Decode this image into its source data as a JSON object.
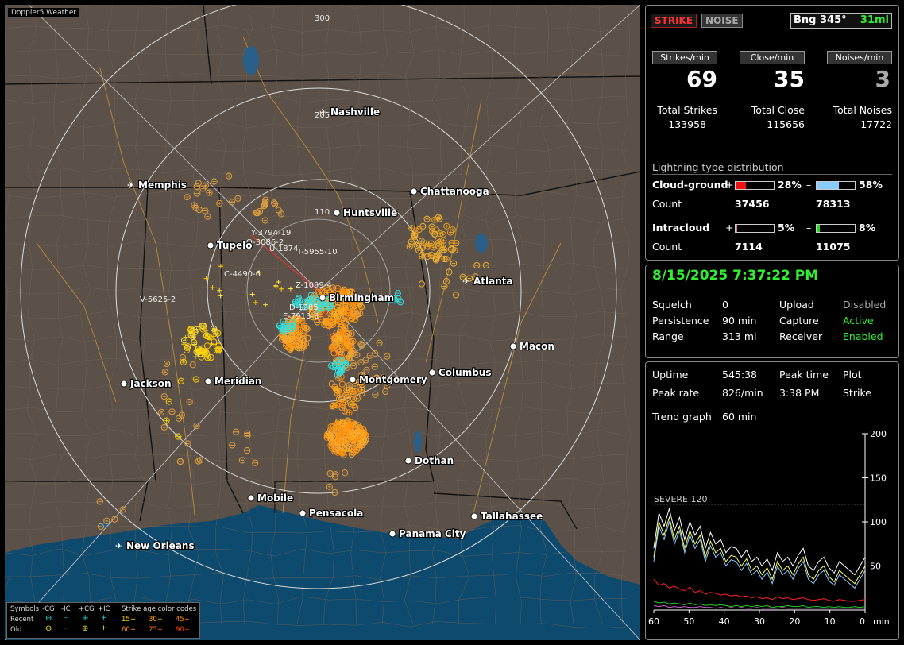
{
  "app": {
    "title": "Doppler5 Weather"
  },
  "map": {
    "range_labels": [
      "300",
      "205",
      "110"
    ],
    "cities": [
      {
        "name": "Nashville",
        "airport": true
      },
      {
        "name": "Memphis",
        "airport": true
      },
      {
        "name": "Chattanooga",
        "airport": false
      },
      {
        "name": "Huntsville",
        "airport": false
      },
      {
        "name": "Tupelo",
        "airport": false
      },
      {
        "name": "Atlanta",
        "airport": true
      },
      {
        "name": "Birmingham",
        "airport": false
      },
      {
        "name": "Macon",
        "airport": false
      },
      {
        "name": "Jackson",
        "airport": false
      },
      {
        "name": "Meridian",
        "airport": false
      },
      {
        "name": "Montgomery",
        "airport": false
      },
      {
        "name": "Columbus",
        "airport": false
      },
      {
        "name": "Dothan",
        "airport": false
      },
      {
        "name": "Mobile",
        "airport": false
      },
      {
        "name": "Pensacola",
        "airport": false
      },
      {
        "name": "Tallahassee",
        "airport": false
      },
      {
        "name": "Panama City",
        "airport": false
      },
      {
        "name": "New Orleans",
        "airport": true
      }
    ],
    "storm_tracks": [
      "Y-3794-19",
      "O-3086-2",
      "U-1874",
      "T-5955-10",
      "C-4490-6",
      "V-5625-2",
      "D-1285",
      "E-7913-8",
      "Z-1099-4"
    ]
  },
  "legend": {
    "symbols_label": "Symbols",
    "cols": [
      "-CG",
      "-IC",
      "+CG",
      "+IC"
    ],
    "recent_label": "Recent",
    "old_label": "Old",
    "age_label": "Strike age color codes",
    "recent_ages": [
      "15+",
      "30+",
      "45+"
    ],
    "old_ages": [
      "60+",
      "75+",
      "90+"
    ],
    "recent_age_colors": [
      "#ffd400",
      "#ffb000",
      "#ff8c00"
    ],
    "old_age_colors": [
      "#ff8c1a",
      "#ff6a00",
      "#ff3c00"
    ]
  },
  "status": {
    "strike_tag": "STRIKE",
    "noise_tag": "NOISE",
    "bearing": "Bng 345°",
    "distance": "31mi"
  },
  "rates": {
    "strikes_label": "Strikes/min",
    "strikes": "69",
    "close_label": "Close/min",
    "close": "35",
    "noises_label": "Noises/min",
    "noises": "3",
    "total_strikes_label": "Total Strikes",
    "total_strikes": "133958",
    "total_close_label": "Total Close",
    "total_close": "115656",
    "total_noises_label": "Total Noises",
    "total_noises": "17722"
  },
  "distribution": {
    "title": "Lightning type distribution",
    "cg_label": "Cloud-ground",
    "cg_pos_pct": "28%",
    "cg_neg_pct": "58%",
    "cg_pos_fill": 0.28,
    "cg_neg_fill": 0.58,
    "count_label": "Count",
    "cg_pos_count": "37456",
    "cg_neg_count": "78313",
    "ic_label": "Intracloud",
    "ic_pos_pct": "5%",
    "ic_neg_pct": "8%",
    "ic_pos_fill": 0.05,
    "ic_neg_fill": 0.08,
    "ic_pos_count": "7114",
    "ic_neg_count": "11075",
    "plus": "+",
    "minus": "–"
  },
  "datetime": "8/15/2025 7:37:22 PM",
  "settings": {
    "squelch_label": "Squelch",
    "squelch": "0",
    "persistence_label": "Persistence",
    "persistence": "90 min",
    "range_label": "Range",
    "range": "313 mi",
    "upload_label": "Upload",
    "upload": "Disabled",
    "capture_label": "Capture",
    "capture": "Active",
    "receiver_label": "Receiver",
    "receiver": "Enabled"
  },
  "stats": {
    "uptime_label": "Uptime",
    "uptime": "545:38",
    "peak_time_label": "Peak time",
    "peak_time": "3:38 PM",
    "plot_label": "Plot",
    "plot": "Strike",
    "peak_rate_label": "Peak rate",
    "peak_rate": "826/min",
    "trend_label": "Trend graph",
    "trend": "60 min"
  },
  "chart_data": {
    "type": "line",
    "severe_label": "SEVERE 120",
    "severe_value": 120,
    "ylim": [
      0,
      200
    ],
    "y_ticks": [
      "200",
      "150",
      "100",
      "50"
    ],
    "x_ticks": [
      "60",
      "50",
      "40",
      "30",
      "20",
      "10",
      "0"
    ],
    "x_unit": "min",
    "xlim": [
      60,
      0
    ],
    "series": [
      {
        "color": "#ffffff",
        "values": [
          70,
          110,
          95,
          115,
          90,
          105,
          80,
          100,
          85,
          95,
          70,
          88,
          75,
          80,
          65,
          72,
          70,
          60,
          68,
          55,
          60,
          50,
          58,
          45,
          65,
          55,
          60,
          50,
          62,
          70,
          50,
          45,
          55,
          60,
          48,
          42,
          55,
          50,
          45,
          40,
          50,
          60
        ]
      },
      {
        "color": "#ffff66",
        "values": [
          60,
          100,
          85,
          105,
          80,
          95,
          70,
          90,
          75,
          85,
          60,
          78,
          65,
          70,
          55,
          62,
          60,
          50,
          58,
          45,
          50,
          40,
          48,
          35,
          55,
          45,
          50,
          40,
          52,
          60,
          40,
          35,
          45,
          50,
          38,
          32,
          45,
          40,
          35,
          30,
          40,
          50
        ]
      },
      {
        "color": "#88ccff",
        "values": [
          55,
          95,
          80,
          100,
          75,
          90,
          65,
          85,
          70,
          80,
          55,
          73,
          60,
          65,
          50,
          57,
          55,
          45,
          53,
          40,
          45,
          35,
          43,
          30,
          50,
          40,
          45,
          35,
          47,
          55,
          35,
          30,
          40,
          45,
          33,
          28,
          40,
          35,
          30,
          25,
          35,
          45
        ]
      },
      {
        "color": "#ff2020",
        "values": [
          35,
          28,
          30,
          25,
          27,
          24,
          22,
          26,
          20,
          22,
          18,
          20,
          19,
          17,
          18,
          16,
          17,
          15,
          16,
          14,
          15,
          13,
          14,
          12,
          15,
          13,
          14,
          12,
          13,
          14,
          12,
          11,
          12,
          13,
          11,
          10,
          12,
          11,
          10,
          10,
          11,
          12
        ]
      },
      {
        "color": "#22cc22",
        "values": [
          10,
          8,
          9,
          7,
          8,
          7,
          6,
          8,
          6,
          7,
          5,
          6,
          5,
          6,
          5,
          4,
          5,
          4,
          5,
          4,
          5,
          4,
          5,
          3,
          4,
          4,
          5,
          4,
          4,
          5,
          3,
          4,
          4,
          3,
          4,
          3,
          4,
          3,
          3,
          4,
          3,
          4
        ]
      },
      {
        "color": "#cc66cc",
        "values": [
          5,
          4,
          5,
          3,
          4,
          3,
          4,
          3,
          3,
          4,
          3,
          3,
          2,
          3,
          2,
          3,
          2,
          3,
          2,
          2,
          3,
          2,
          2,
          2,
          2,
          3,
          2,
          2,
          2,
          2,
          2,
          2,
          2,
          2,
          2,
          2,
          2,
          2,
          2,
          2,
          2,
          2
        ]
      }
    ]
  }
}
